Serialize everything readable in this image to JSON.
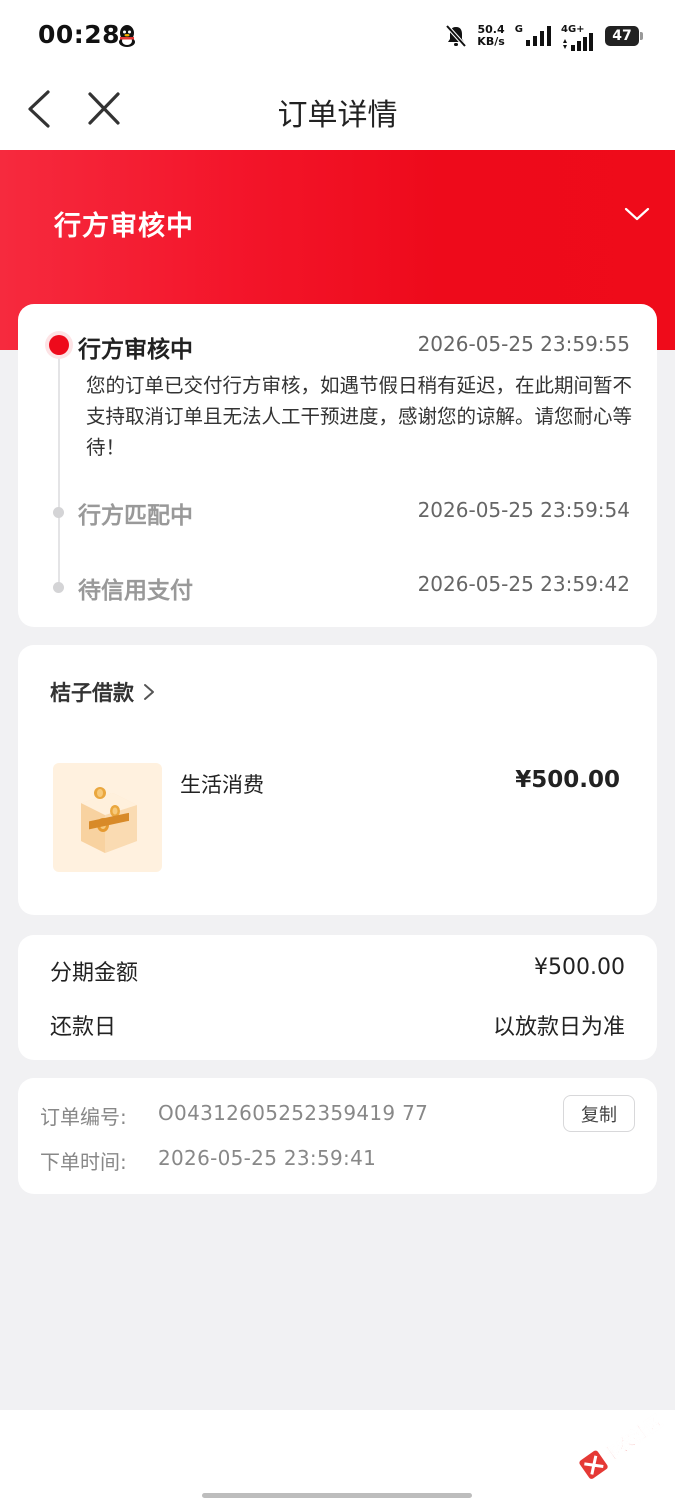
{
  "status_bar": {
    "time": "00:28",
    "net_speed_value": "50.4",
    "net_speed_unit": "KB/s",
    "network_type_1": "G",
    "network_type_2": "4G+",
    "battery": "47"
  },
  "nav": {
    "title": "订单详情"
  },
  "hero": {
    "status_title": "行方审核中"
  },
  "timeline": [
    {
      "title": "行方审核中",
      "time": "2026-05-25 23:59:55",
      "desc": "您的订单已交付行方审核，如遇节假日稍有延迟，在此期间暂不支持取消订单且无法人工干预进度，感谢您的谅解。请您耐心等待！"
    },
    {
      "title": "行方匹配中",
      "time": "2026-05-25 23:59:54"
    },
    {
      "title": "待信用支付",
      "time": "2026-05-25 23:59:42"
    }
  ],
  "product": {
    "store_name": "桔子借款",
    "item_name": "生活消费",
    "price": "¥500.00"
  },
  "summary": {
    "installment_label": "分期金额",
    "installment_value": "¥500.00",
    "repay_label": "还款日",
    "repay_value": "以放款日为准"
  },
  "order": {
    "id_label": "订单编号:",
    "id_value": "O04312605252359419 77",
    "time_label": "下单时间:",
    "time_value": "2026-05-25 23:59:41",
    "copy_label": "复制"
  },
  "watermark": {
    "text": "卡农社区"
  },
  "colors": {
    "accent_red": "#ee0a1b",
    "page_bg": "#f1f1f3"
  }
}
